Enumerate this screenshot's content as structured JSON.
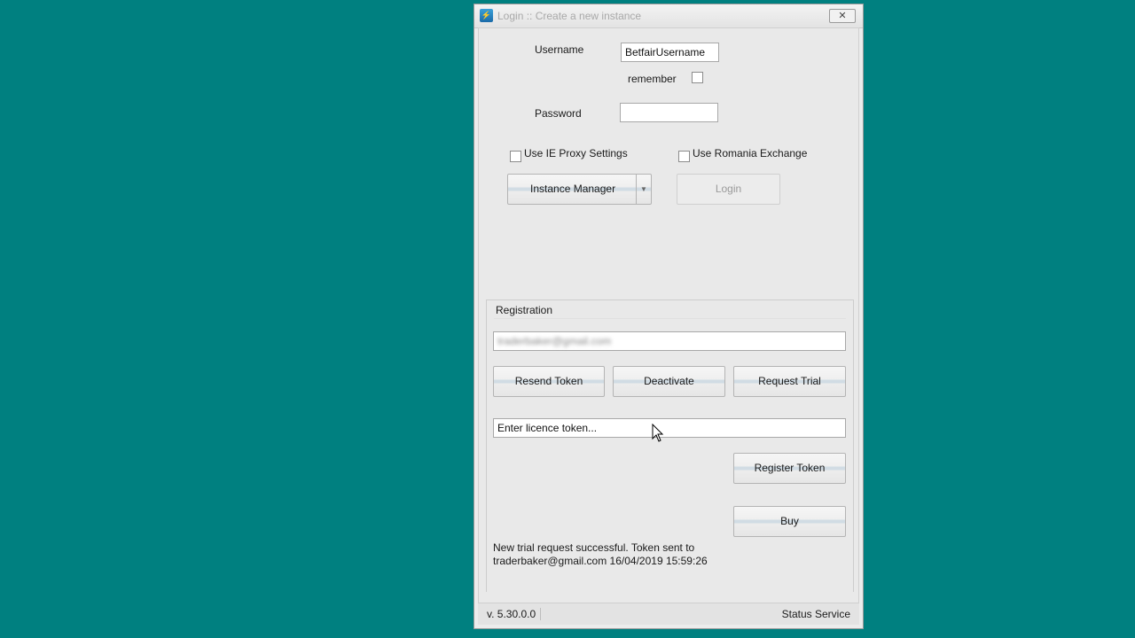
{
  "window": {
    "title": "Login :: Create a new instance",
    "close_glyph": "✕",
    "icon": "app-logo-icon"
  },
  "login": {
    "username_label": "Username",
    "username_value": "BetfairUsername",
    "remember_label": "remember",
    "remember_checked": false,
    "password_label": "Password",
    "password_value": "",
    "ie_proxy_label": "Use IE Proxy Settings",
    "ie_proxy_checked": false,
    "romania_label": "Use Romania Exchange",
    "romania_checked": false,
    "instance_manager_label": "Instance Manager",
    "login_button_label": "Login"
  },
  "registration": {
    "title": "Registration",
    "email_value": "traderbaker@gmail.com",
    "resend_label": "Resend Token",
    "deactivate_label": "Deactivate",
    "request_trial_label": "Request Trial",
    "licence_placeholder": "Enter licence token...",
    "register_label": "Register Token",
    "buy_label": "Buy",
    "message_line1": "New trial request successful. Token sent to",
    "message_line2": "traderbaker@gmail.com 16/04/2019 15:59:26"
  },
  "status": {
    "version": "v. 5.30.0.0",
    "service": "Status Service"
  },
  "colors": {
    "desktop": "#008080",
    "window": "#ececec"
  }
}
